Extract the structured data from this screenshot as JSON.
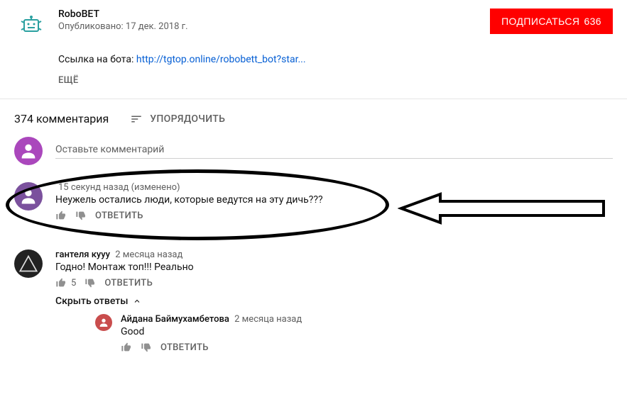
{
  "channel": {
    "name": "RoboBET",
    "publishedLabel": "Опубликовано: 17 дек. 2018 г."
  },
  "subscribe": {
    "label": "ПОДПИСАТЬСЯ",
    "count": "636"
  },
  "description": {
    "prefix": "Ссылка на бота: ",
    "linkText": "http://tgtop.online/robobett_bot?star...",
    "showMore": "ЕЩЁ"
  },
  "commentsHeader": {
    "count": "374 комментария",
    "sortLabel": "УПОРЯДОЧИТЬ"
  },
  "addComment": {
    "placeholder": "Оставьте комментарий"
  },
  "comments": [
    {
      "author": "",
      "time": "15 секунд назад (изменено)",
      "text": "Неужель остались люди, которые ведутся на эту дичь???",
      "likes": "",
      "replyLabel": "ОТВЕТИТЬ"
    },
    {
      "author": "гантеля кууу",
      "time": "2 месяца назад",
      "text": "Годно! Монтаж топ!!! Реально",
      "likes": "5",
      "replyLabel": "ОТВЕТИТЬ",
      "hideReplies": "Скрыть ответы",
      "replies": [
        {
          "author": "Айдана Баймухамбетова",
          "time": "2 месяца назад",
          "text": "Good",
          "replyLabel": "ОТВЕТИТЬ"
        }
      ]
    }
  ]
}
